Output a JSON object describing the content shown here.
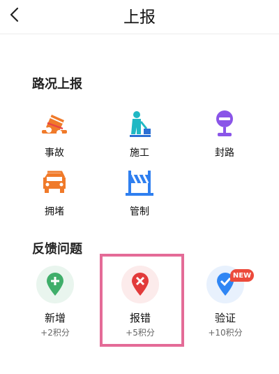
{
  "header": {
    "title": "上报"
  },
  "road": {
    "title": "路况上报",
    "items": [
      {
        "label": "事故",
        "icon": "accident-icon"
      },
      {
        "label": "施工",
        "icon": "construction-icon"
      },
      {
        "label": "封路",
        "icon": "road-closed-icon"
      },
      {
        "label": "拥堵",
        "icon": "congestion-icon"
      },
      {
        "label": "管制",
        "icon": "traffic-control-icon"
      }
    ]
  },
  "feedback": {
    "title": "反馈问题",
    "items": [
      {
        "label": "新增",
        "points": "+2积分",
        "icon": "add-location-icon",
        "color": "#3fae6a"
      },
      {
        "label": "报错",
        "points": "+5积分",
        "icon": "error-location-icon",
        "color": "#e23b3b"
      },
      {
        "label": "验证",
        "points": "+10积分",
        "icon": "verify-location-icon",
        "color": "#2f86f4",
        "badge": "NEW"
      }
    ]
  },
  "colors": {
    "accent_highlight": "#e46b97",
    "orange": "#f07a2a",
    "teal": "#20b8c4",
    "purple": "#8a55e8",
    "blue": "#2f7ff0"
  }
}
